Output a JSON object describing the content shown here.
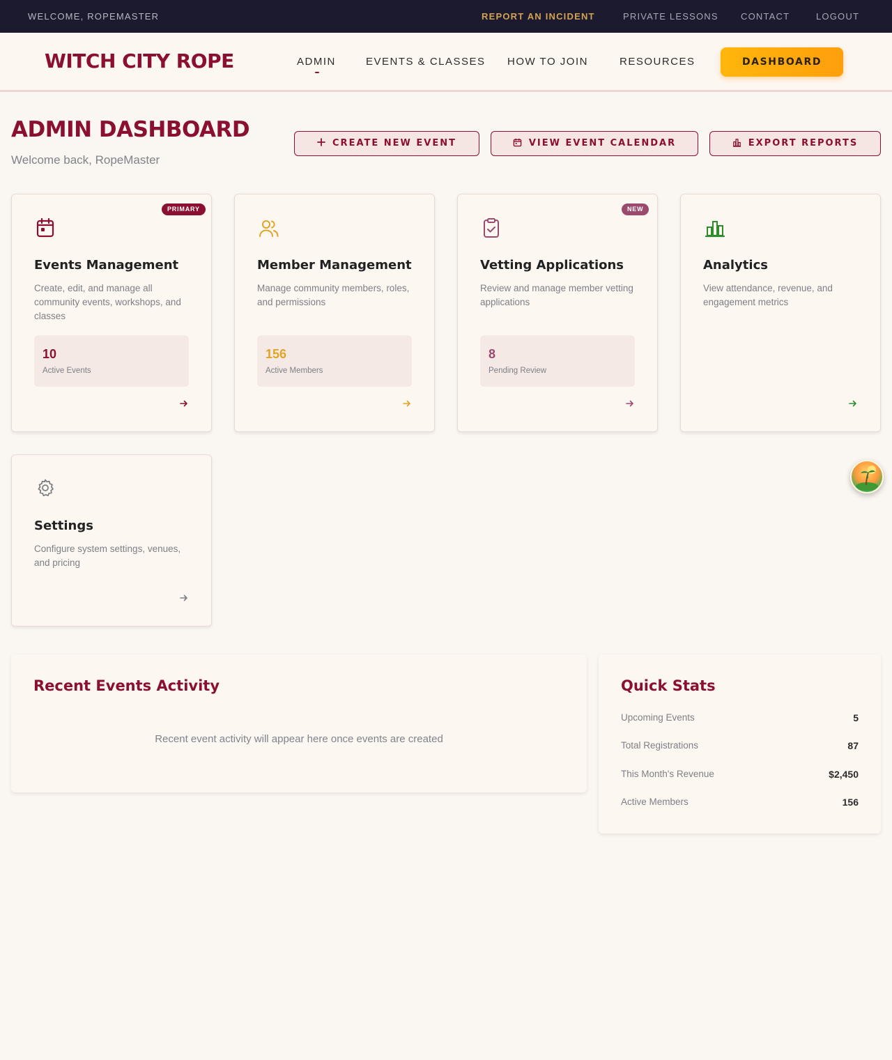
{
  "colors": {
    "brand": "#8b0f2f",
    "accent_gold": "#d3a253",
    "events_icon": "#8b0f2f",
    "members_icon": "#e0a526",
    "vetting_icon": "#9b4a6e",
    "analytics_icon": "#2e8b2e",
    "settings_icon": "#7d7f86"
  },
  "utility": {
    "welcome": "Welcome, RopeMaster",
    "report_incident": "Report an Incident",
    "private_lessons": "Private Lessons",
    "contact": "Contact",
    "logout": "Logout"
  },
  "header": {
    "logo": "Witch City Rope",
    "nav": {
      "admin": "Admin",
      "events": "Events & Classes",
      "join": "How to Join",
      "resources": "Resources"
    },
    "dashboard_button": "Dashboard"
  },
  "page": {
    "title": "Admin Dashboard",
    "subtitle": "Welcome back, RopeMaster",
    "actions": {
      "create": "Create New Event",
      "calendar": "View Event Calendar",
      "export": "Export Reports"
    }
  },
  "cards": {
    "events": {
      "icon": "calendar-icon",
      "badge": "Primary",
      "title": "Events Management",
      "description": "Create, edit, and manage all community events, workshops, and classes",
      "stat_value": "10",
      "stat_label": "Active Events"
    },
    "members": {
      "icon": "users-icon",
      "title": "Member Management",
      "description": "Manage community members, roles, and permissions",
      "stat_value": "156",
      "stat_label": "Active Members"
    },
    "vetting": {
      "icon": "clipboard-check-icon",
      "badge": "New",
      "title": "Vetting Applications",
      "description": "Review and manage member vetting applications",
      "stat_value": "8",
      "stat_label": "Pending Review"
    },
    "analytics": {
      "icon": "bar-chart-icon",
      "title": "Analytics",
      "description": "View attendance, revenue, and engagement metrics"
    },
    "settings": {
      "icon": "gear-icon",
      "title": "Settings",
      "description": "Configure system settings, venues, and pricing"
    }
  },
  "recent": {
    "title": "Recent Events Activity",
    "empty": "Recent event activity will appear here once events are created"
  },
  "quick_stats": {
    "title": "Quick Stats",
    "rows": [
      {
        "label": "Upcoming Events",
        "value": "5"
      },
      {
        "label": "Total Registrations",
        "value": "87"
      },
      {
        "label": "This Month's Revenue",
        "value": "$2,450"
      },
      {
        "label": "Active Members",
        "value": "156"
      }
    ]
  }
}
